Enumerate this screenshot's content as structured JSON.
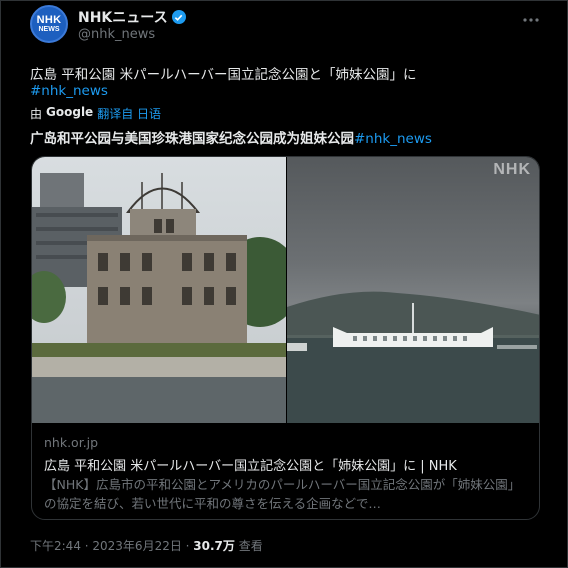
{
  "header": {
    "account_name": "NHKニュース",
    "handle": "@nhk_news",
    "avatar_text_top": "NHK",
    "avatar_text_bottom": "NEWS",
    "verified_icon": "verified-badge-icon",
    "more_icon": "more-icon"
  },
  "tweet": {
    "text": "広島 平和公園 米パールハーバー国立記念公園と「姉妹公園」に",
    "hashtag": "#nhk_news",
    "translated_by_prefix": "由",
    "translated_by_service": "Google",
    "translated_by_suffix": "翻译自 日语",
    "translated_text": "广岛和平公园与美国珍珠港国家纪念公园成为姐妹公园",
    "translated_hashtag": "#nhk_news"
  },
  "card": {
    "watermark": "NHK",
    "domain": "nhk.or.jp",
    "title": "広島 平和公園 米パールハーバー国立記念公園と「姉妹公園」に | NHK",
    "description": "【NHK】広島市の平和公園とアメリカのパールハーバー国立記念公園が「姉妹公園」の協定を結び、若い世代に平和の尊さを伝える企画などで…"
  },
  "footer": {
    "time": "下午2:44 · 2023年6月22日 · ",
    "views_count": "30.7万",
    "views_label": " 查看"
  },
  "colors": {
    "background": "#000000",
    "text": "#e7e9ea",
    "muted": "#71767b",
    "accent": "#1d9bf0",
    "border": "#2f3336"
  }
}
